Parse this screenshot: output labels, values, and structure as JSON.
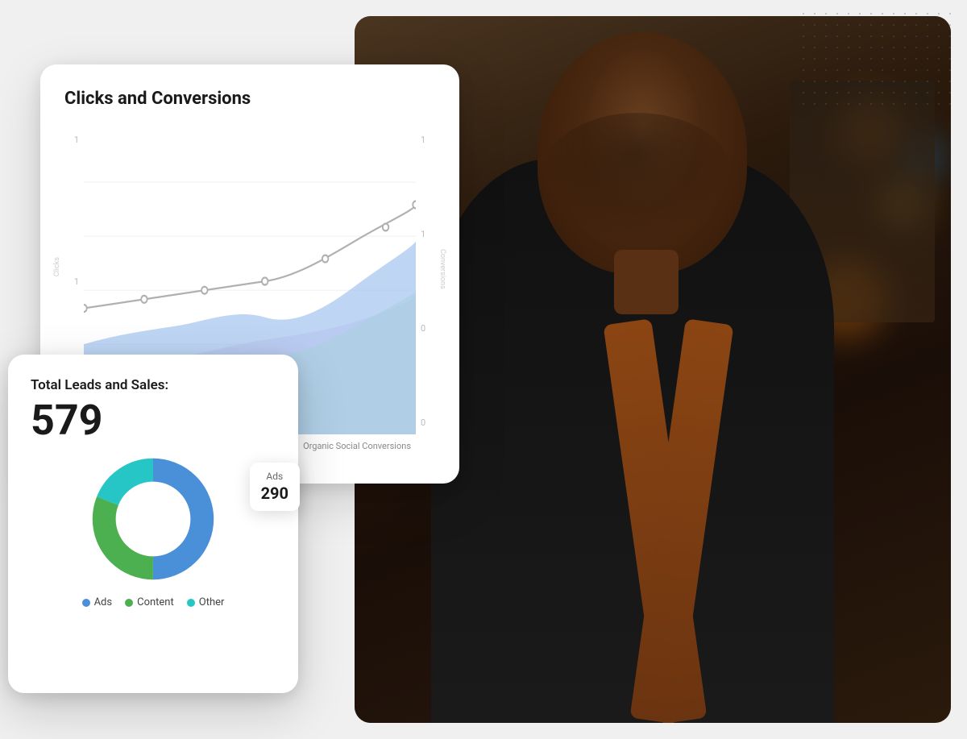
{
  "clicks_card": {
    "title": "Clicks and Conversions",
    "y_axis_left_label": "Clicks",
    "y_axis_right_label": "Conversions",
    "y_values_left": [
      "1",
      "1",
      "1"
    ],
    "y_values_right": [
      "1",
      "1",
      "0",
      "0"
    ],
    "bottom_label": "Organic Social Conversions"
  },
  "leads_card": {
    "title": "Total Leads and Sales:",
    "total": "579",
    "tooltip": {
      "label": "Ads",
      "value": "290"
    },
    "legend": [
      {
        "label": "Ads",
        "color": "#4A90D9"
      },
      {
        "label": "Content",
        "color": "#4CAF50"
      },
      {
        "label": "Other",
        "color": "#26C6C6"
      }
    ],
    "donut_segments": [
      {
        "label": "Ads",
        "value": 290,
        "color": "#4A90D9",
        "percent": 50
      },
      {
        "label": "Content",
        "value": 180,
        "color": "#4CAF50",
        "percent": 31
      },
      {
        "label": "Other",
        "value": 109,
        "color": "#26C6C6",
        "percent": 19
      }
    ]
  },
  "dots": {
    "color": "#555"
  }
}
